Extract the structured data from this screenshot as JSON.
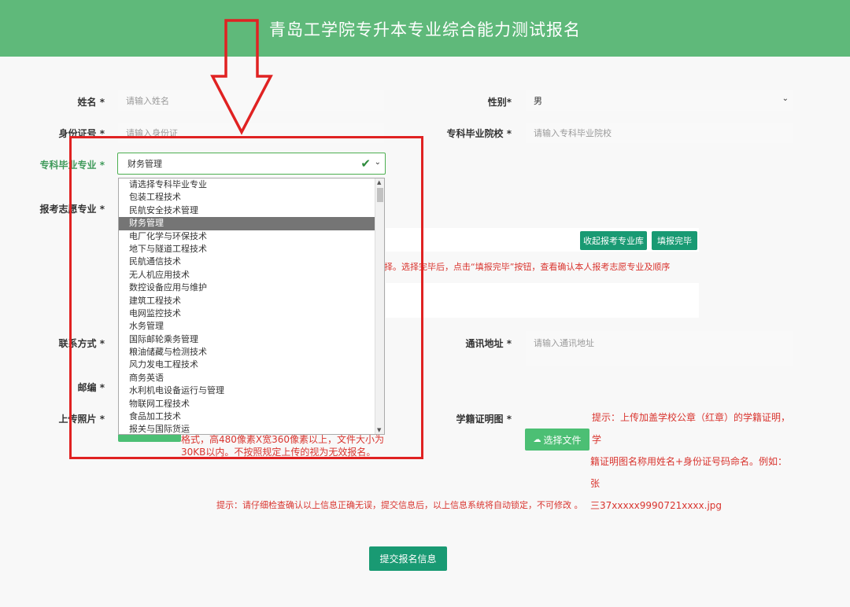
{
  "header": {
    "title": "青岛工学院专升本专业综合能力测试报名"
  },
  "form": {
    "name_label": "姓名 *",
    "name_placeholder": "请输入姓名",
    "gender_label": "性别*",
    "gender_value": "男",
    "id_label": "身份证号 *",
    "id_placeholder": "请输入身份证",
    "school_label": "专科毕业院校 *",
    "school_placeholder": "请输入专科毕业院校",
    "major_label": "专科毕业专业 *",
    "major_value": "财务管理",
    "apply_label": "报考志愿专业 *",
    "btn_collapse": "收起报考专业库",
    "btn_done": "填报完毕",
    "apply_hint": "择。选择完毕后，点击“填报完毕”按钮，查看确认本人报考志愿专业及顺序",
    "contact_label": "联系方式 *",
    "address_label": "通讯地址 *",
    "address_placeholder": "请输入通讯地址",
    "postcode_label": "邮编 *",
    "photo_label": "上传照片 *",
    "photo_hint_line1": "格式，高480像素X宽360像素以上，文件大小为",
    "photo_hint_line2": "30KB以内。不按照规定上传的视为无效报名。",
    "status_label": "学籍证明图 *",
    "upload_btn": "选择文件",
    "status_hint_line1": "提示：上传加盖学校公章（红章）的学籍证明，学",
    "status_hint_line2": "籍证明图名称用姓名+身份证号码命名。例如：张",
    "status_hint_line3": "三37xxxxx9990721xxxx.jpg",
    "bottom_hint": "提示：请仔细检查确认以上信息正确无误，提交信息后，以上信息系统将自动锁定，不可修改 。",
    "submit_btn": "提交报名信息"
  },
  "dropdown_options": [
    "请选择专科毕业专业",
    "包装工程技术",
    "民航安全技术管理",
    "财务管理",
    "电厂化学与环保技术",
    "地下与隧道工程技术",
    "民航通信技术",
    "无人机应用技术",
    "数控设备应用与维护",
    "建筑工程技术",
    "电网监控技术",
    "水务管理",
    "国际邮轮乘务管理",
    "粮油储藏与检测技术",
    "风力发电工程技术",
    "商务英语",
    "水利机电设备运行与管理",
    "物联网工程技术",
    "食品加工技术",
    "报关与国际货运"
  ],
  "dropdown_selected_index": 3,
  "colors": {
    "header": "#5fb97a",
    "button": "#199a73",
    "annotation": "#e02222",
    "hint": "#d9352f"
  }
}
